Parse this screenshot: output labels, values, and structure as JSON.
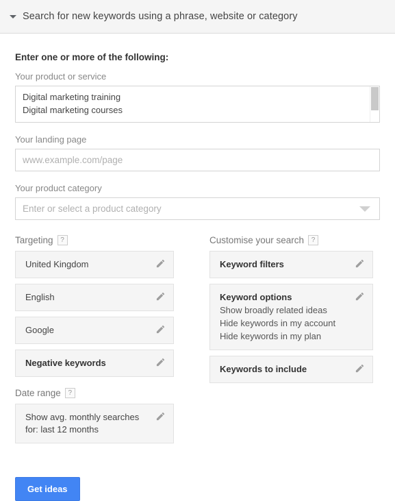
{
  "header": {
    "title": "Search for new keywords using a phrase, website or category",
    "collapse_icon": "triangle-down-icon"
  },
  "form": {
    "intro": "Enter one or more of the following:",
    "product_or_service": {
      "label": "Your product or service",
      "lines": [
        "Digital marketing training",
        "Digital marketing courses"
      ]
    },
    "landing_page": {
      "label": "Your landing page",
      "placeholder": "www.example.com/page",
      "value": ""
    },
    "product_category": {
      "label": "Your product category",
      "placeholder": "Enter or select a product category",
      "value": "",
      "caret_icon": "chevron-down-icon"
    }
  },
  "targeting": {
    "heading": "Targeting",
    "help": "?",
    "items": [
      {
        "title": "United Kingdom",
        "bold": false,
        "edit_icon": "pencil-icon"
      },
      {
        "title": "English",
        "bold": false,
        "edit_icon": "pencil-icon"
      },
      {
        "title": "Google",
        "bold": false,
        "edit_icon": "pencil-icon"
      },
      {
        "title": "Negative keywords",
        "bold": true,
        "edit_icon": "pencil-icon"
      }
    ]
  },
  "date_range": {
    "heading": "Date range",
    "help": "?",
    "line1": "Show avg. monthly searches",
    "line2": "for: last 12 months",
    "edit_icon": "pencil-icon"
  },
  "customise": {
    "heading": "Customise your search",
    "help": "?",
    "keyword_filters": {
      "title": "Keyword filters",
      "edit_icon": "pencil-icon"
    },
    "keyword_options": {
      "title": "Keyword options",
      "options": [
        "Show broadly related ideas",
        "Hide keywords in my account",
        "Hide keywords in my plan"
      ],
      "edit_icon": "pencil-icon"
    },
    "keywords_to_include": {
      "title": "Keywords to include",
      "edit_icon": "pencil-icon"
    }
  },
  "actions": {
    "get_ideas_label": "Get ideas"
  },
  "colors": {
    "accent": "#4285f4",
    "header_bg": "#f5f5f5",
    "box_bg": "#f5f5f5",
    "text": "#333333",
    "muted": "#888888"
  }
}
